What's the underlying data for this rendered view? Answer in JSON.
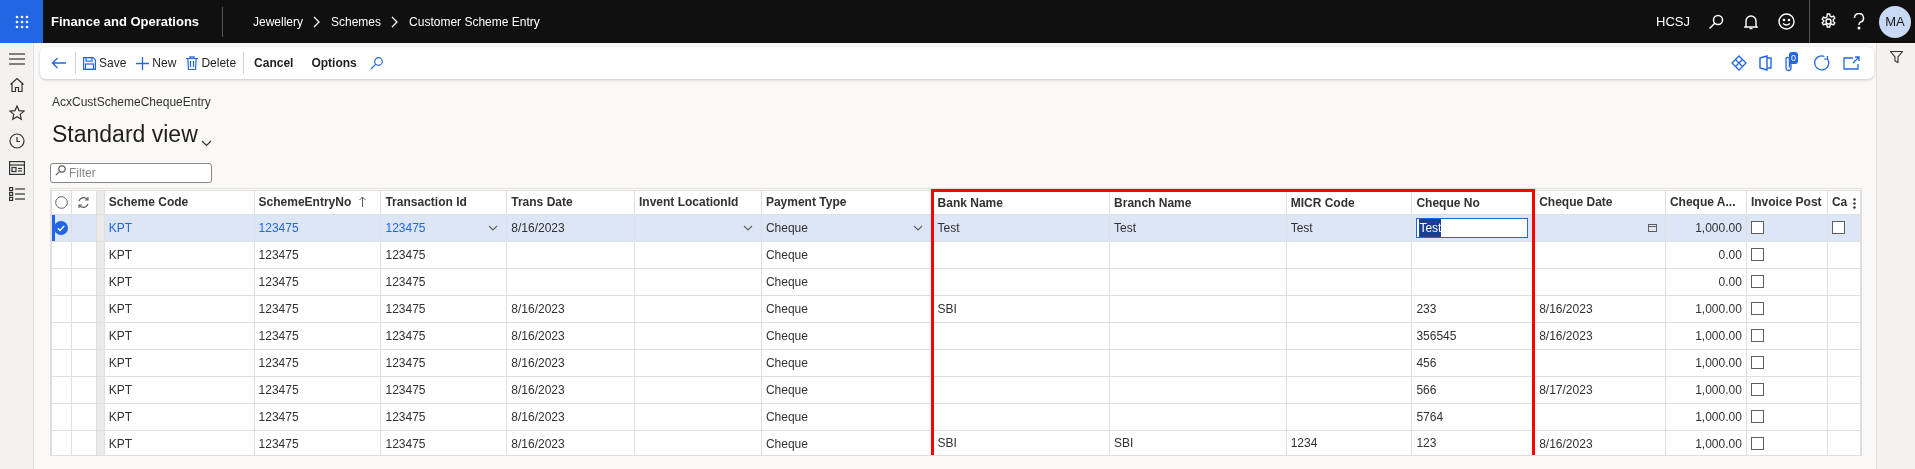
{
  "top_bar": {
    "app_name": "Finance and Operations",
    "breadcrumb": [
      "Jewellery",
      "Schemes",
      "Customer Scheme Entry"
    ],
    "company": "HCSJ",
    "avatar": "MA"
  },
  "toolbar": {
    "buttons": [
      {
        "kind": "back"
      },
      {
        "kind": "save",
        "label": "Save"
      },
      {
        "kind": "new",
        "label": "New"
      },
      {
        "kind": "delete",
        "label": "Delete"
      },
      {
        "kind": "cancel",
        "label": "Cancel"
      },
      {
        "kind": "options",
        "label": "Options"
      },
      {
        "kind": "search"
      }
    ],
    "attachments_badge": "0"
  },
  "form": {
    "name": "AcxCustSchemeChequeEntry",
    "view_title": "Standard view",
    "filter": {
      "placeholder": "Filter"
    }
  },
  "table": {
    "select_all_checked": false,
    "columns": [
      {
        "label": "Scheme Code",
        "kind": "link",
        "highlighted": false,
        "sorted": false
      },
      {
        "label": "SchemeEntryNo",
        "kind": "link",
        "highlighted": false,
        "sorted": true
      },
      {
        "label": "Transaction Id",
        "kind": "dropdown_link",
        "highlighted": false,
        "sorted": false
      },
      {
        "label": "Trans Date",
        "kind": "text",
        "highlighted": false,
        "sorted": false
      },
      {
        "label": "Invent LocationId",
        "kind": "dropdown",
        "highlighted": false,
        "sorted": false
      },
      {
        "label": "Payment Type",
        "kind": "dropdown",
        "highlighted": false,
        "sorted": false
      },
      {
        "label": "Bank Name",
        "kind": "text",
        "highlighted": true,
        "sorted": false
      },
      {
        "label": "Branch Name",
        "kind": "text",
        "highlighted": true,
        "sorted": false
      },
      {
        "label": "MICR Code",
        "kind": "text",
        "highlighted": true,
        "sorted": false
      },
      {
        "label": "Cheque No",
        "kind": "text",
        "highlighted": true,
        "sorted": false
      },
      {
        "label": "Cheque Date",
        "kind": "date",
        "highlighted": false,
        "sorted": false
      },
      {
        "label": "Cheque A...",
        "kind": "amount",
        "highlighted": false,
        "sorted": false
      },
      {
        "label": "Invoice Post",
        "kind": "checkbox",
        "highlighted": false,
        "sorted": false
      },
      {
        "label": "Ca",
        "kind": "checkbox",
        "highlighted": false,
        "sorted": false
      }
    ],
    "rows": [
      {
        "selected": true,
        "cells": [
          "KPT",
          "123475",
          "123475",
          "8/16/2023",
          "",
          "Cheque",
          "Test",
          "Test",
          "Test",
          {
            "text": "Test",
            "editing": true
          },
          "",
          "1,000.00",
          {
            "checked": false
          },
          {
            "checked": false
          }
        ]
      },
      {
        "selected": false,
        "cells": [
          "KPT",
          "123475",
          "123475",
          "",
          "",
          "Cheque",
          "",
          "",
          "",
          "",
          "",
          "0.00",
          {
            "checked": false
          },
          null
        ]
      },
      {
        "selected": false,
        "cells": [
          "KPT",
          "123475",
          "123475",
          "",
          "",
          "Cheque",
          "",
          "",
          "",
          "",
          "",
          "0.00",
          {
            "checked": false
          },
          null
        ]
      },
      {
        "selected": false,
        "cells": [
          "KPT",
          "123475",
          "123475",
          "8/16/2023",
          "",
          "Cheque",
          "SBI",
          "",
          "",
          "233",
          "8/16/2023",
          "1,000.00",
          {
            "checked": false
          },
          null
        ]
      },
      {
        "selected": false,
        "cells": [
          "KPT",
          "123475",
          "123475",
          "8/16/2023",
          "",
          "Cheque",
          "",
          "",
          "",
          "356545",
          "8/16/2023",
          "1,000.00",
          {
            "checked": false
          },
          null
        ]
      },
      {
        "selected": false,
        "cells": [
          "KPT",
          "123475",
          "123475",
          "8/16/2023",
          "",
          "Cheque",
          "",
          "",
          "",
          "456",
          "",
          "1,000.00",
          {
            "checked": false
          },
          null
        ]
      },
      {
        "selected": false,
        "cells": [
          "KPT",
          "123475",
          "123475",
          "8/16/2023",
          "",
          "Cheque",
          "",
          "",
          "",
          "566",
          "8/17/2023",
          "1,000.00",
          {
            "checked": false
          },
          null
        ]
      },
      {
        "selected": false,
        "cells": [
          "KPT",
          "123475",
          "123475",
          "8/16/2023",
          "",
          "Cheque",
          "",
          "",
          "",
          "5764",
          "",
          "1,000.00",
          {
            "checked": false
          },
          null
        ]
      },
      {
        "selected": false,
        "cells": [
          "KPT",
          "123475",
          "123475",
          "8/16/2023",
          "",
          "Cheque",
          "SBI",
          "SBI",
          "1234",
          "123",
          "8/16/2023",
          "1,000.00",
          {
            "checked": false
          },
          null
        ]
      }
    ]
  }
}
